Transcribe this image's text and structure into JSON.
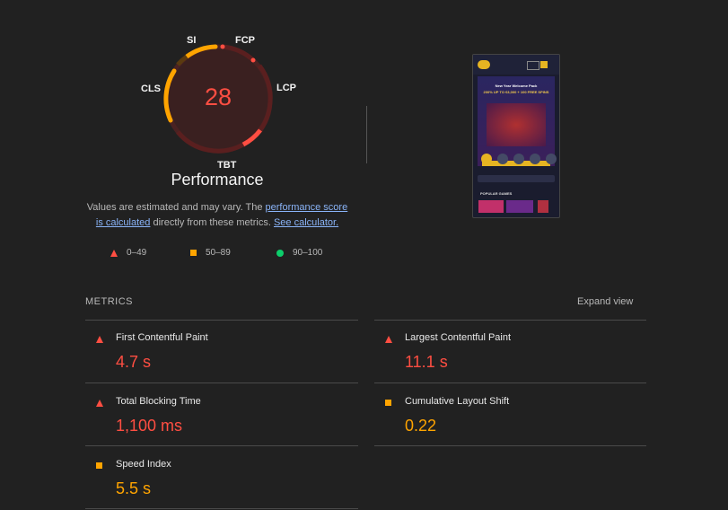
{
  "score": {
    "value": "28",
    "title": "Performance",
    "labels": {
      "si": "SI",
      "fcp": "FCP",
      "lcp": "LCP",
      "tbt": "TBT",
      "cls": "CLS"
    }
  },
  "description": {
    "part1": "Values are estimated and may vary. The ",
    "link1": "performance score is calculated",
    "part2": " directly from these metrics. ",
    "link2": "See calculator."
  },
  "legend": [
    {
      "range": "0–49",
      "shape": "triangle",
      "color": "#ff4e42"
    },
    {
      "range": "50–89",
      "shape": "square",
      "color": "#ffa400"
    },
    {
      "range": "90–100",
      "shape": "circle",
      "color": "#0cce6b"
    }
  ],
  "screenshot": {
    "headline": "New Year Welcome Pack",
    "offer": "200% UP TO €3,000 + 100 FREE SPINS",
    "section": "POPULAR GAMES"
  },
  "metrics": {
    "header": "METRICS",
    "expand": "Expand view",
    "items": [
      {
        "name": "First Contentful Paint",
        "value": "4.7 s",
        "rating": "red"
      },
      {
        "name": "Largest Contentful Paint",
        "value": "11.1 s",
        "rating": "red"
      },
      {
        "name": "Total Blocking Time",
        "value": "1,100 ms",
        "rating": "red"
      },
      {
        "name": "Cumulative Layout Shift",
        "value": "0.22",
        "rating": "orange"
      },
      {
        "name": "Speed Index",
        "value": "5.5 s",
        "rating": "orange"
      }
    ]
  }
}
